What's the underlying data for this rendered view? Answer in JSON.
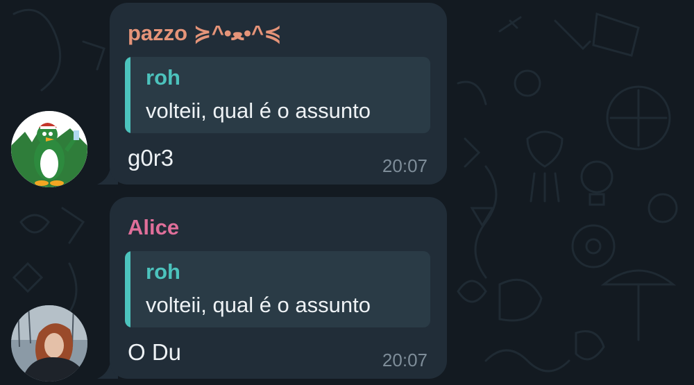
{
  "messages": [
    {
      "sender": "pazzo ≽^•ﻌ•^≼",
      "sender_color": "#e59479",
      "avatar": "penguin-avatar",
      "reply": {
        "name": "roh",
        "text": "volteii, qual é o assunto"
      },
      "text": "g0r3",
      "time": "20:07"
    },
    {
      "sender": "Alice",
      "sender_color": "#e06f9a",
      "avatar": "photo-avatar",
      "reply": {
        "name": "roh",
        "text": "volteii, qual é o assunto"
      },
      "text": "O Du",
      "time": "20:07"
    }
  ],
  "colors": {
    "background": "#131a21",
    "bubble": "#212d38",
    "reply_bg": "#2a3b46",
    "reply_accent": "#4cc3bd",
    "time": "#7e8d99"
  }
}
